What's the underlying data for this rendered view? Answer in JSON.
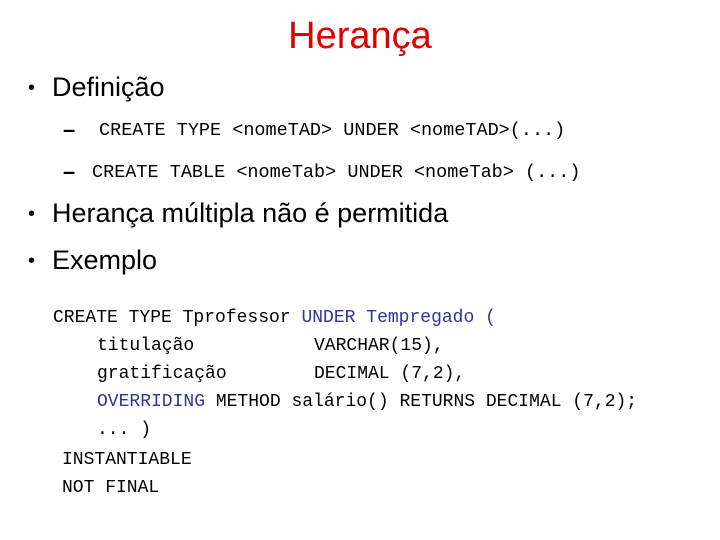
{
  "slide": {
    "title": "Herança",
    "title_color": "#e00000",
    "keyword_color": "#333399",
    "bullet_icon": "bullet-dot-icon",
    "bullet_glyph": "•",
    "dash_glyph": "–",
    "bullets": [
      {
        "text": "Definição",
        "sub_items": [
          "CREATE TYPE <nomeTAD> UNDER <nomeTAD>(...)",
          "CREATE TABLE <nomeTab> UNDER <nomeTab> (...)"
        ]
      },
      {
        "text": "Herança múltipla não é permitida"
      },
      {
        "text": "Exemplo"
      }
    ],
    "code_example": {
      "line1": {
        "plain": "CREATE TYPE Tprofessor ",
        "keyword": "UNDER Tempregado ("
      },
      "line2": {
        "name": "titulação",
        "type": "VARCHAR(15),"
      },
      "line3": {
        "name": "gratificação",
        "type": "DECIMAL (7,2),"
      },
      "line4": {
        "keyword": "OVERRIDING",
        "plain": " METHOD salário() RETURNS DECIMAL (7,2);"
      },
      "line5": "... )",
      "line6": "INSTANTIABLE",
      "line7": "NOT FINAL"
    }
  }
}
